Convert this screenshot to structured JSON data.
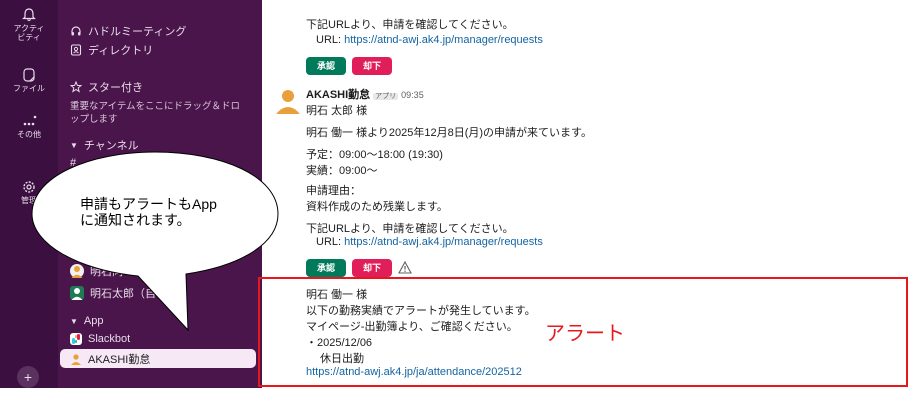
{
  "rail": {
    "items": [
      {
        "label": "アクティビティ",
        "icon": "bell-icon"
      },
      {
        "label": "ファイル",
        "icon": "files-icon"
      },
      {
        "label": "その他",
        "icon": "more-icon"
      },
      {
        "label": "管理",
        "icon": "gear-icon"
      }
    ],
    "activity_line1": "アクティ",
    "activity_line2": "ビティ",
    "add_label": "+"
  },
  "sidebar": {
    "huddle": "ハドルミーティング",
    "directory": "ディレクトリ",
    "starred": "スター付き",
    "starred_hint": "重要なアイテムをここにドラッグ＆ドロップします",
    "channels": "チャンネル",
    "dm_partial_1": "明石同",
    "dm_partial_2": "明石太郎（自",
    "app_section": "App",
    "slackbot": "Slackbot",
    "akashi_app": "AKASHI勤怠"
  },
  "callout": {
    "line1": "申請もアラートもApp",
    "line2": "に通知されます。"
  },
  "messages": {
    "top_confirm": "下記URLより、申請を確認してください。",
    "top_url_label": "URL: ",
    "top_url": "https://atnd-awj.ak4.jp/manager/requests",
    "approve": "承認",
    "reject": "却下",
    "sender": "AKASHI勤怠",
    "app_badge": "アプリ",
    "time": "09:35",
    "greeting": "明石 太郎 様",
    "request_line": "明石 働一 様より2025年12月8日(月)の申請が来ています。",
    "scheduled": "予定：09:00〜18:00 (19:30)",
    "actual": "実績：09:00〜",
    "reason_label": "申請理由：",
    "reason": "資料作成のため残業します。",
    "confirm": "下記URLより、申請を確認してください。",
    "url_label": "URL: ",
    "url": "https://atnd-awj.ak4.jp/manager/requests",
    "alert_greeting": "明石 働一 様",
    "alert_line1": "以下の勤務実績でアラートが発生しています。",
    "alert_line2": "マイページ-出勤簿より、ご確認ください。",
    "alert_date": "・2025/12/06",
    "alert_type": "休日出勤",
    "alert_url": "https://atnd-awj.ak4.jp/ja/attendance/202512"
  },
  "annotation": {
    "alert_label": "アラート"
  },
  "colors": {
    "rail": "#3b0f40",
    "sidebar": "#4a154b",
    "approve": "#007a5a",
    "reject": "#e01e5a",
    "link": "#1264a3",
    "alert_red": "#e8171b"
  }
}
